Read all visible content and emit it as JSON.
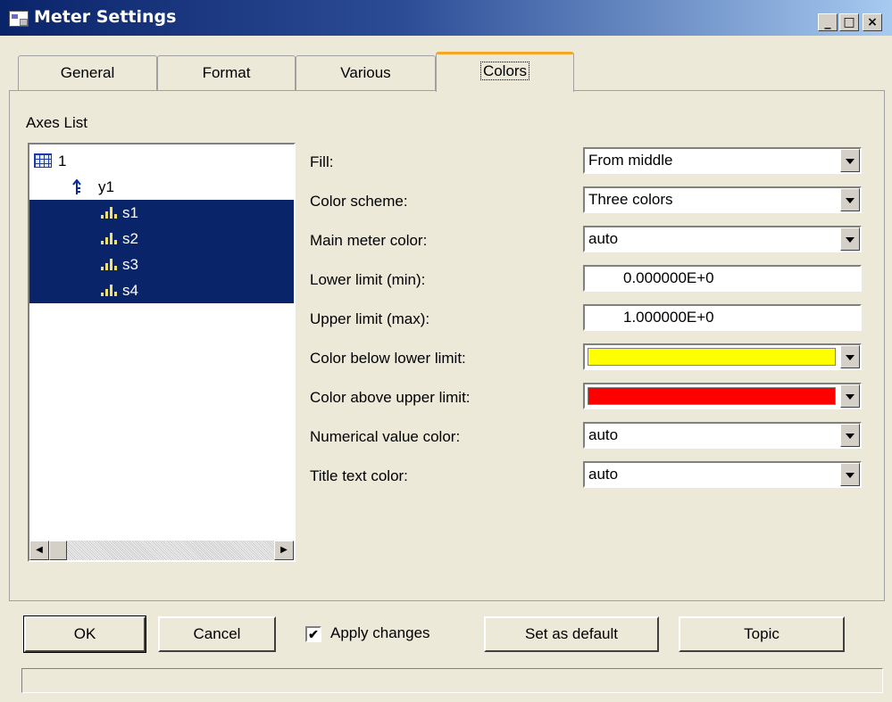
{
  "window": {
    "title": "Meter Settings",
    "minimize": "_",
    "maximize": "□",
    "close": "×"
  },
  "tabs": [
    {
      "label": "General"
    },
    {
      "label": "Format"
    },
    {
      "label": "Various"
    },
    {
      "label": "Colors",
      "active": true
    }
  ],
  "axes_list": {
    "label": "Axes List",
    "items": [
      {
        "label": "1",
        "icon": "grid-icon"
      },
      {
        "label": "y1",
        "icon": "axis-icon"
      },
      {
        "label": "s1",
        "icon": "bar-chart-icon",
        "selected": true
      },
      {
        "label": "s2",
        "icon": "bar-chart-icon",
        "selected": true
      },
      {
        "label": "s3",
        "icon": "bar-chart-icon",
        "selected": true
      },
      {
        "label": "s4",
        "icon": "bar-chart-icon",
        "selected": true
      }
    ],
    "scroll_left": "◀",
    "scroll_right": "▶"
  },
  "fields": {
    "fill": {
      "label": "Fill:",
      "value": "From middle"
    },
    "color_scheme": {
      "label": "Color scheme:",
      "value": "Three colors"
    },
    "main_meter_color": {
      "label": "Main meter color:",
      "value": "auto"
    },
    "lower_limit": {
      "label": "Lower limit (min):",
      "value": "0.000000E+0"
    },
    "upper_limit": {
      "label": "Upper limit (max):",
      "value": "1.000000E+0"
    },
    "color_below": {
      "label": "Color below lower limit:",
      "color": "#ffff00"
    },
    "color_above": {
      "label": "Color above upper limit:",
      "color": "#ff0000"
    },
    "numerical_value_color": {
      "label": "Numerical value color:",
      "value": "auto"
    },
    "title_text_color": {
      "label": "Title text color:",
      "value": "auto"
    }
  },
  "buttons": {
    "ok": "OK",
    "cancel": "Cancel",
    "apply_changes": {
      "label": "Apply changes",
      "checked": true,
      "mark": "✔"
    },
    "set_default": "Set as default",
    "topic": "Topic"
  },
  "colors": {
    "selection": "#0a246a",
    "active_tab_accent": "#f5a623",
    "dialog_bg": "#ece9d8"
  }
}
